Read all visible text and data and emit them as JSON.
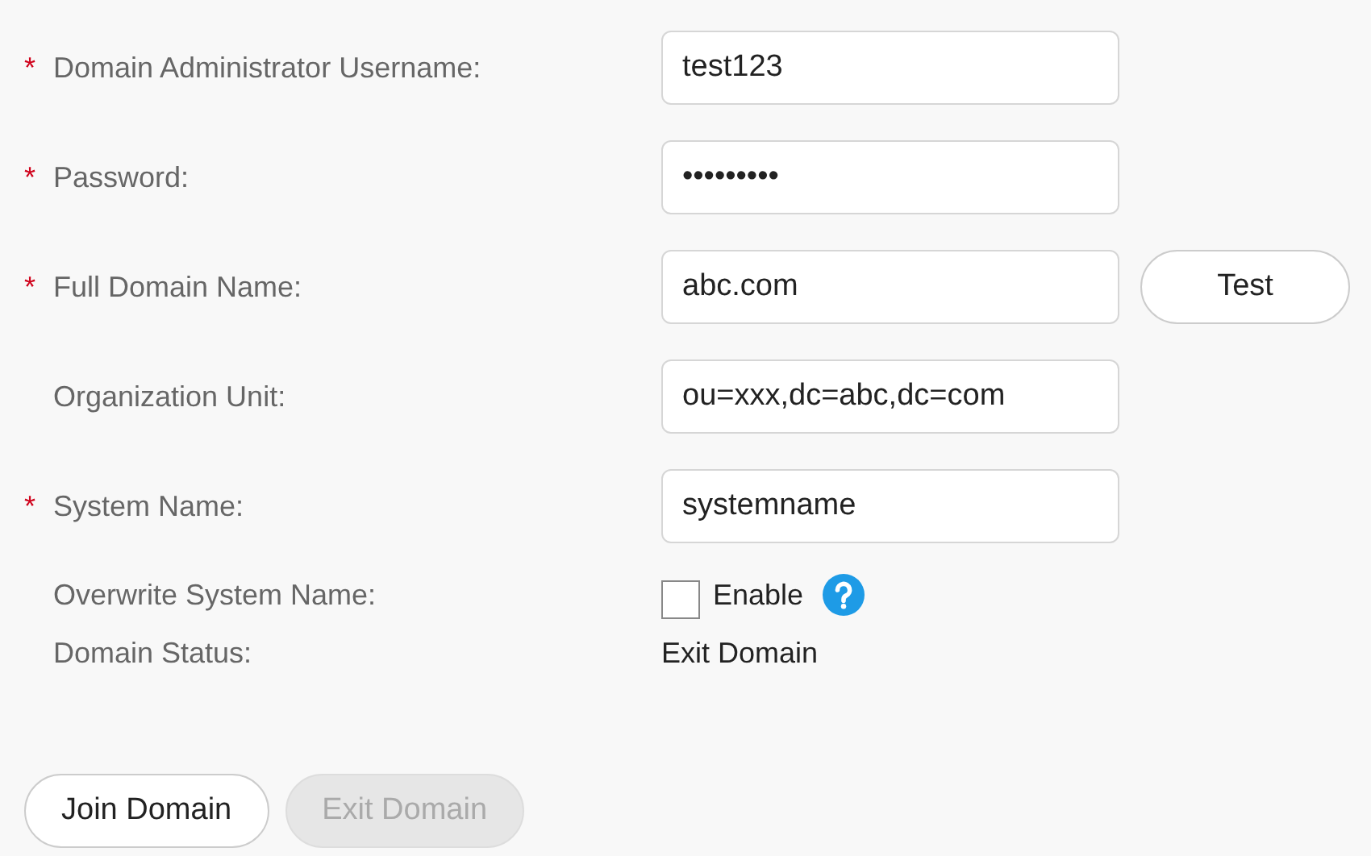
{
  "fields": [
    {
      "kind": "input",
      "label": "Domain Administrator Username:",
      "required": true,
      "value": "test123"
    },
    {
      "kind": "input",
      "label": "Password:",
      "required": true,
      "value": "•••••••••"
    },
    {
      "kind": "input",
      "label": "Full Domain Name:",
      "required": true,
      "value": "abc.com",
      "button": "Test"
    },
    {
      "kind": "input",
      "label": "Organization Unit:",
      "required": false,
      "value": "ou=xxx,dc=abc,dc=com"
    },
    {
      "kind": "input",
      "label": "System Name:",
      "required": true,
      "value": "systemname"
    },
    {
      "kind": "checkbox",
      "label": "Overwrite System Name:",
      "required": false,
      "checked": false,
      "option": "Enable",
      "help": true
    },
    {
      "kind": "status",
      "label": "Domain Status:",
      "required": false,
      "value": "Exit Domain"
    }
  ],
  "buttons": [
    {
      "label": "Join Domain",
      "disabled": false
    },
    {
      "label": "Exit Domain",
      "disabled": true
    }
  ],
  "required_mark": "*"
}
